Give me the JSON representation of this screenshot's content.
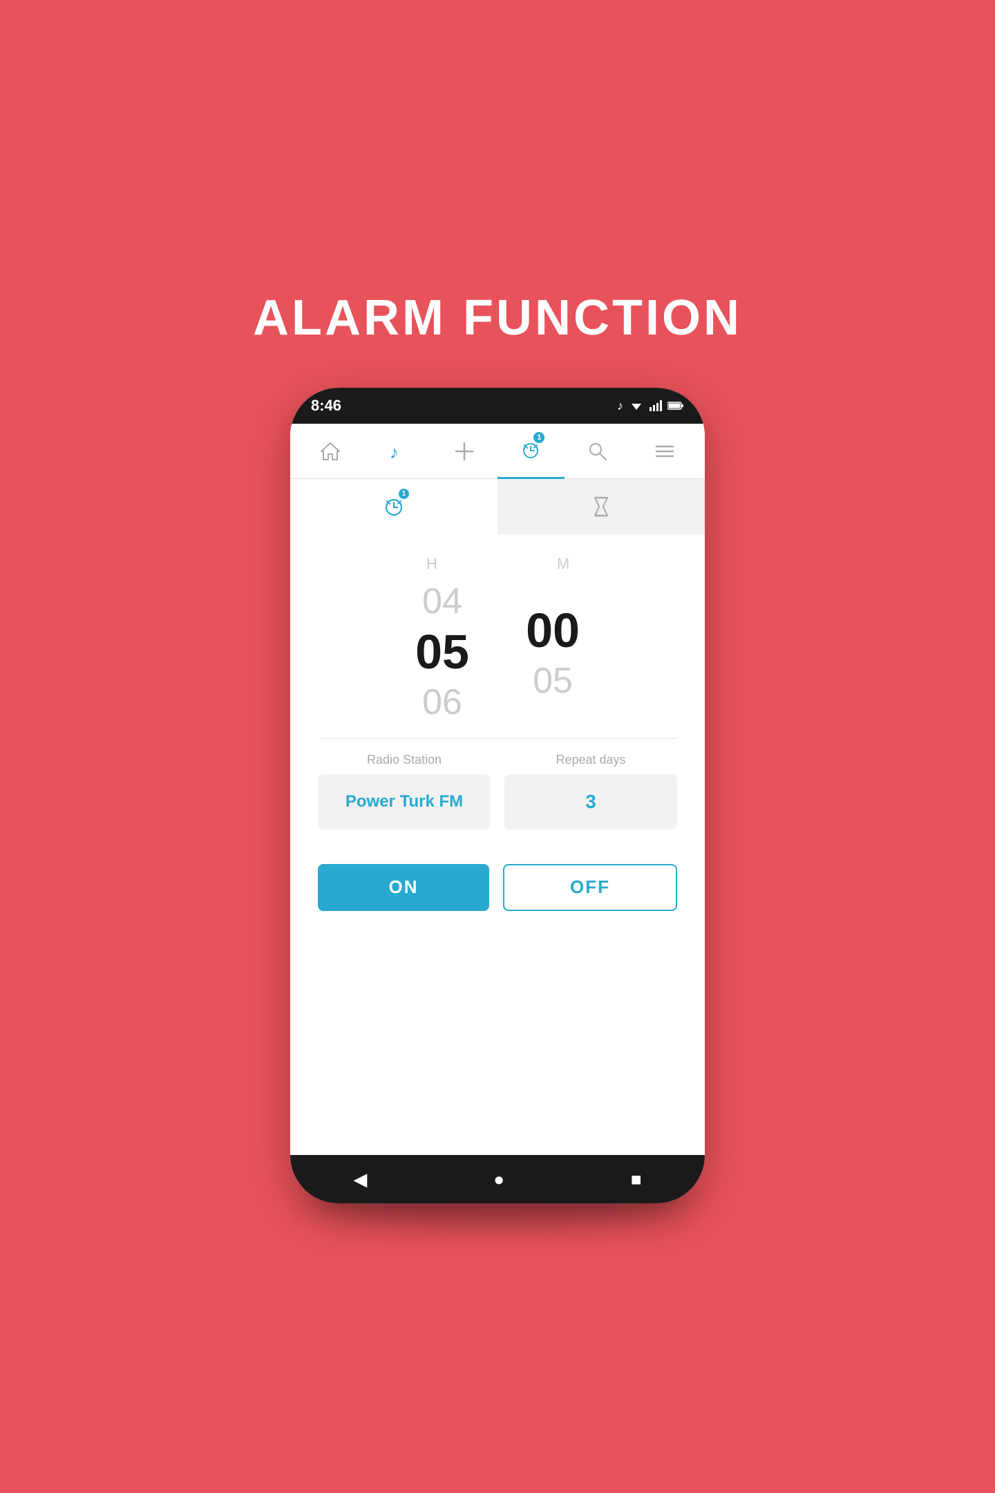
{
  "page": {
    "title": "ALARM FUNCTION",
    "bg_color": "#e8525a"
  },
  "status_bar": {
    "time": "8:46",
    "music_icon": "♪",
    "wifi": "wifi",
    "signal": "signal",
    "battery": "battery"
  },
  "top_nav": {
    "items": [
      {
        "id": "home",
        "icon": "⌂",
        "label": "Home",
        "active": false,
        "badge": null
      },
      {
        "id": "music",
        "icon": "♪",
        "label": "Music",
        "active": false,
        "badge": null
      },
      {
        "id": "add",
        "icon": "+",
        "label": "Add",
        "active": false,
        "badge": null
      },
      {
        "id": "alarm",
        "icon": "alarm",
        "label": "Alarm",
        "active": true,
        "badge": "1"
      },
      {
        "id": "search",
        "icon": "⌕",
        "label": "Search",
        "active": false,
        "badge": null
      },
      {
        "id": "menu",
        "icon": "≡",
        "label": "Menu",
        "active": false,
        "badge": null
      }
    ]
  },
  "sub_nav": {
    "items": [
      {
        "id": "alarm-tab",
        "icon": "alarm",
        "label": "Alarm",
        "active": true,
        "badge": "1"
      },
      {
        "id": "timer-tab",
        "icon": "timer",
        "label": "Timer",
        "active": false,
        "badge": null
      }
    ]
  },
  "time_picker": {
    "h_label": "H",
    "m_label": "M",
    "hour_prev": "04",
    "hour_current": "05",
    "hour_next": "06",
    "min_prev": "",
    "min_current": "00",
    "min_next": "05"
  },
  "settings": {
    "radio_station_label": "Radio Station",
    "radio_station_value": "Power Turk FM",
    "repeat_days_label": "Repeat days",
    "repeat_days_value": "3"
  },
  "buttons": {
    "on_label": "ON",
    "off_label": "OFF"
  },
  "bottom_bar": {
    "back": "◀",
    "home": "●",
    "recent": "■"
  }
}
